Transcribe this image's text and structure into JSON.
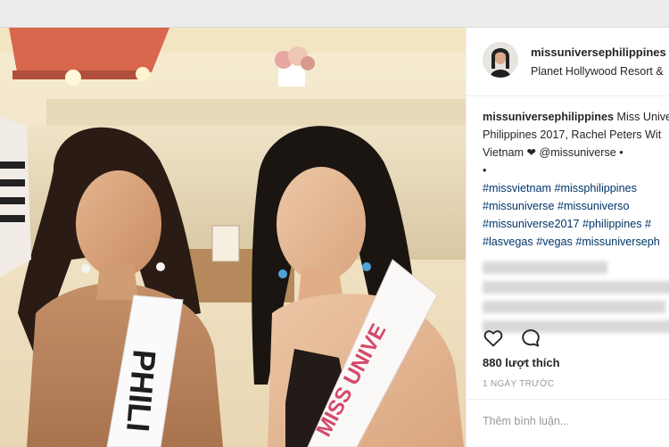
{
  "post": {
    "username": "missuniversephilippines",
    "header_dot": "•",
    "location": "Planet Hollywood Resort &",
    "caption": {
      "user": "missuniversephilippines",
      "line1_text": "Miss Unive",
      "line2": "Philippines 2017, Rachel Peters Wit",
      "line3": "Vietnam ❤ @missuniverse •",
      "line4": "•",
      "line5": "#missvietnam #missphilippines",
      "line6": "#missuniverse #missuniverso",
      "line7": "#missuniverse2017 #philippines #",
      "line8": "#lasvegas #vegas #missuniverseph"
    },
    "likes": "880 lượt thích",
    "time": "1 NGÀY TRƯỚC",
    "comment_placeholder": "Thêm bình luận...",
    "photo": {
      "sash_left_text": "PHILI",
      "sash_right_text": "MISS UNIVE"
    }
  },
  "icons": {
    "like": "heart-icon",
    "comment": "comment-icon"
  }
}
